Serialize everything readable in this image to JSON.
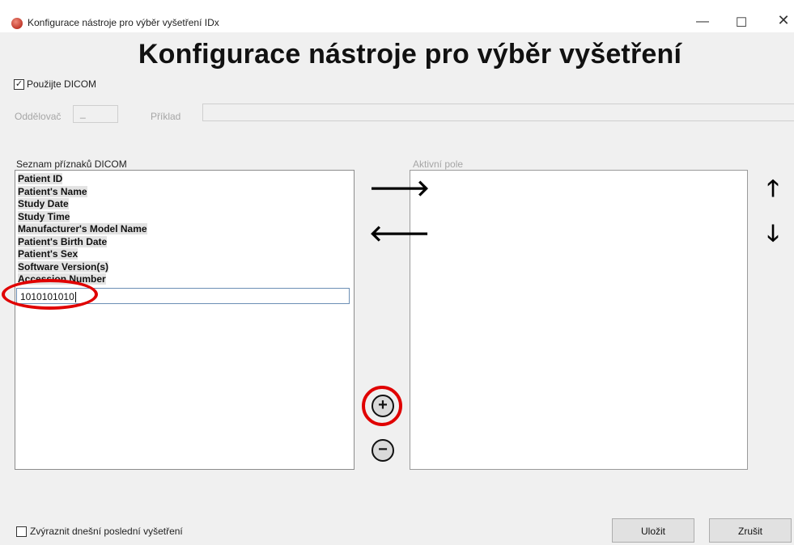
{
  "window": {
    "title": "Konfigurace nástroje pro výběr vyšetření IDx",
    "minimize_glyph": "—",
    "maximize_glyph": "☐",
    "close_glyph": "✕"
  },
  "heading": "Konfigurace nástroje pro výběr vyšetření",
  "use_dicom": {
    "label": "Použijte DICOM",
    "checked": true,
    "check_glyph": "✓"
  },
  "separator": {
    "label": "Oddělovač",
    "value": "_"
  },
  "example": {
    "label": "Příklad",
    "value": ""
  },
  "dicom_list": {
    "label": "Seznam příznaků DICOM",
    "items": [
      "Patient ID",
      "Patient's Name",
      "Study Date",
      "Study Time",
      "Manufacturer's Model Name",
      "Patient's Birth Date",
      "Patient's Sex",
      "Software Version(s)",
      "Accession Number"
    ],
    "edit_value": "1010101010"
  },
  "active_fields": {
    "label": "Aktivní pole",
    "items": []
  },
  "buttons": {
    "move_right": "🡒",
    "move_left": "🡐",
    "move_up": "🡑",
    "move_down": "🡓",
    "add": "+",
    "remove": "−",
    "save": "Uložit",
    "cancel": "Zrušit"
  },
  "highlight_today": {
    "label": "Zvýraznit dnešní poslední vyšetření",
    "checked": false
  },
  "colors": {
    "annotation_red": "#e00000",
    "list_border": "#8c8c8c",
    "window_bg": "#f0f0f0"
  }
}
